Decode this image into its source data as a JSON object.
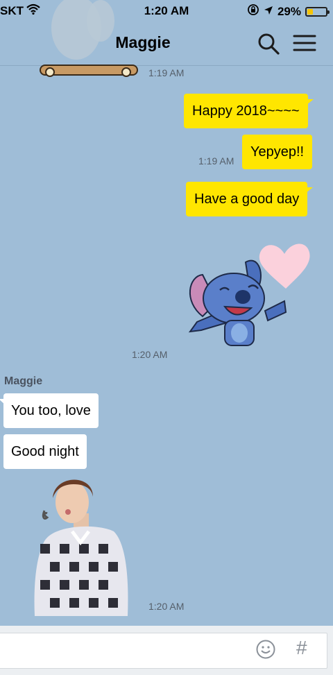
{
  "status_bar": {
    "carrier": "SKT",
    "time": "1:20 AM",
    "battery": "29%",
    "battery_level": 0.29
  },
  "header": {
    "title": "Maggie"
  },
  "messages": {
    "time_1": "1:19 AM",
    "out_1": "Happy 2018~~~~",
    "out_2": "Yepyep!!",
    "time_2": "1:19 AM",
    "out_3": "Have a good day",
    "time_3": "1:20 AM",
    "sender": "Maggie",
    "in_1": "You too, love",
    "in_2": "Good night",
    "time_4": "1:20 AM"
  },
  "input": {
    "hash_label": "#"
  },
  "icons": [
    "wifi-icon",
    "rotation-lock-icon",
    "location-arrow-icon",
    "battery-icon",
    "search-icon",
    "menu-icon",
    "emoji-icon"
  ]
}
